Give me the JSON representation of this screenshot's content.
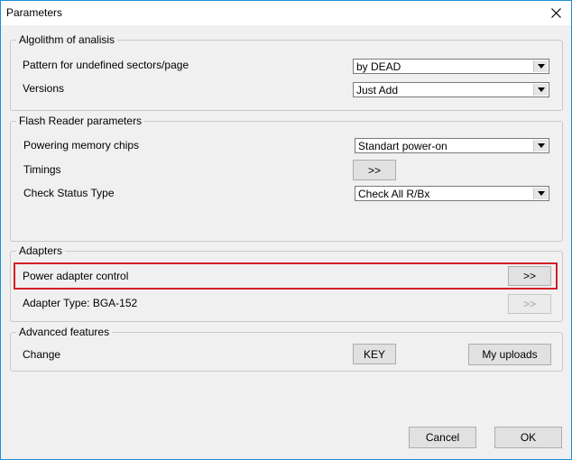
{
  "window": {
    "title": "Parameters"
  },
  "algorithm": {
    "legend": "Algolithm of analisis",
    "pattern_label": "Pattern for undefined sectors/page",
    "pattern_value": "by DEAD",
    "versions_label": "Versions",
    "versions_value": "Just Add"
  },
  "flash_reader": {
    "legend": "Flash Reader parameters",
    "powering_label": "Powering memory chips",
    "powering_value": "Standart power-on",
    "timings_label": "Timings",
    "timings_button": ">>",
    "check_status_label": "Check Status Type",
    "check_status_value": "Check All R/Bx"
  },
  "adapters": {
    "legend": "Adapters",
    "power_control_label": "Power adapter control",
    "power_control_button": ">>",
    "adapter_type_label": "Adapter Type: BGA-152",
    "adapter_type_button": ">>"
  },
  "advanced": {
    "legend": "Advanced features",
    "change_label": "Change",
    "key_button": "KEY",
    "uploads_button": "My uploads"
  },
  "footer": {
    "cancel_button": "Cancel",
    "ok_button": "OK"
  },
  "colors": {
    "window_border": "#1e8fd6",
    "highlight": "#d32027"
  }
}
